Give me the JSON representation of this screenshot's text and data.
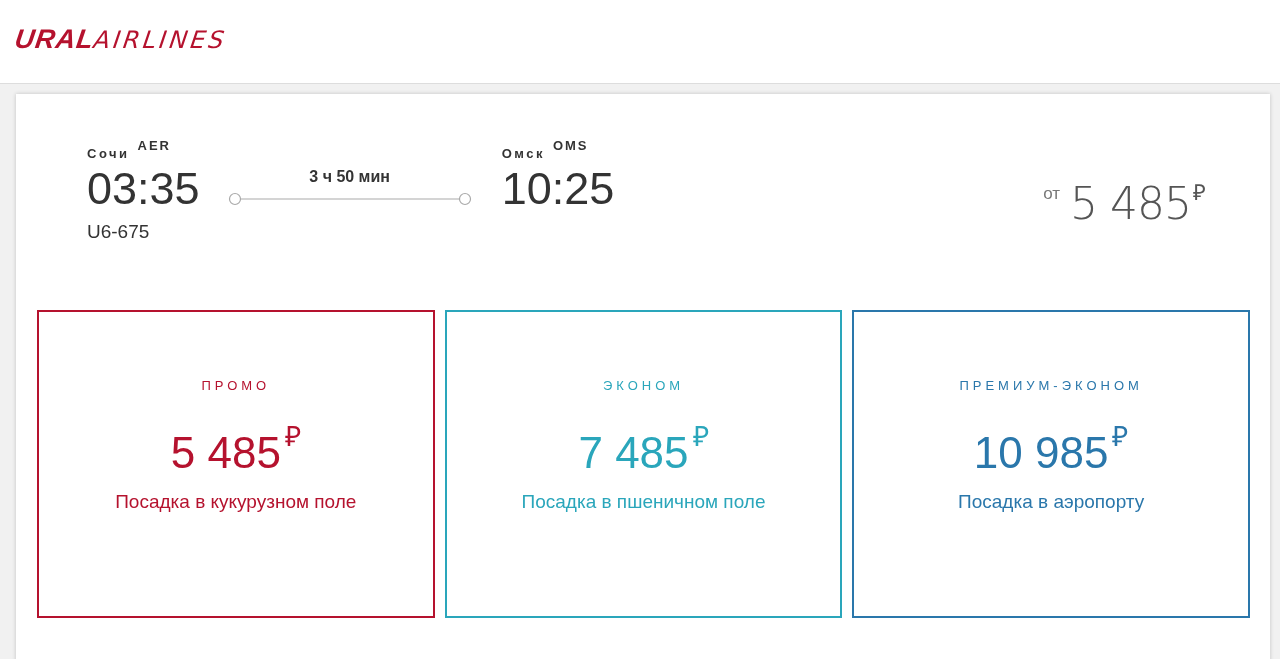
{
  "logo": {
    "bold": "URAL",
    "light": "AIRLINES"
  },
  "flight": {
    "from": {
      "city": "Сочи",
      "code": "AER",
      "time": "03:35"
    },
    "flight_number": "U6-675",
    "duration": "3 ч 50 мин",
    "to": {
      "city": "Омск",
      "code": "OMS",
      "time": "10:25"
    },
    "price_prefix": "от",
    "price": "5 485",
    "currency": "₽"
  },
  "fares": [
    {
      "name": "ПРОМО",
      "price": "5 485",
      "currency": "₽",
      "description": "Посадка в кукурузном поле",
      "color": "#b5122e"
    },
    {
      "name": "ЭКОНОМ",
      "price": "7 485",
      "currency": "₽",
      "description": "Посадка в пшеничном поле",
      "color": "#2aa6bb"
    },
    {
      "name": "ПРЕМИУМ-ЭКОНОМ",
      "price": "10 985",
      "currency": "₽",
      "description": "Посадка в аэропорту",
      "color": "#2a77ab"
    }
  ]
}
